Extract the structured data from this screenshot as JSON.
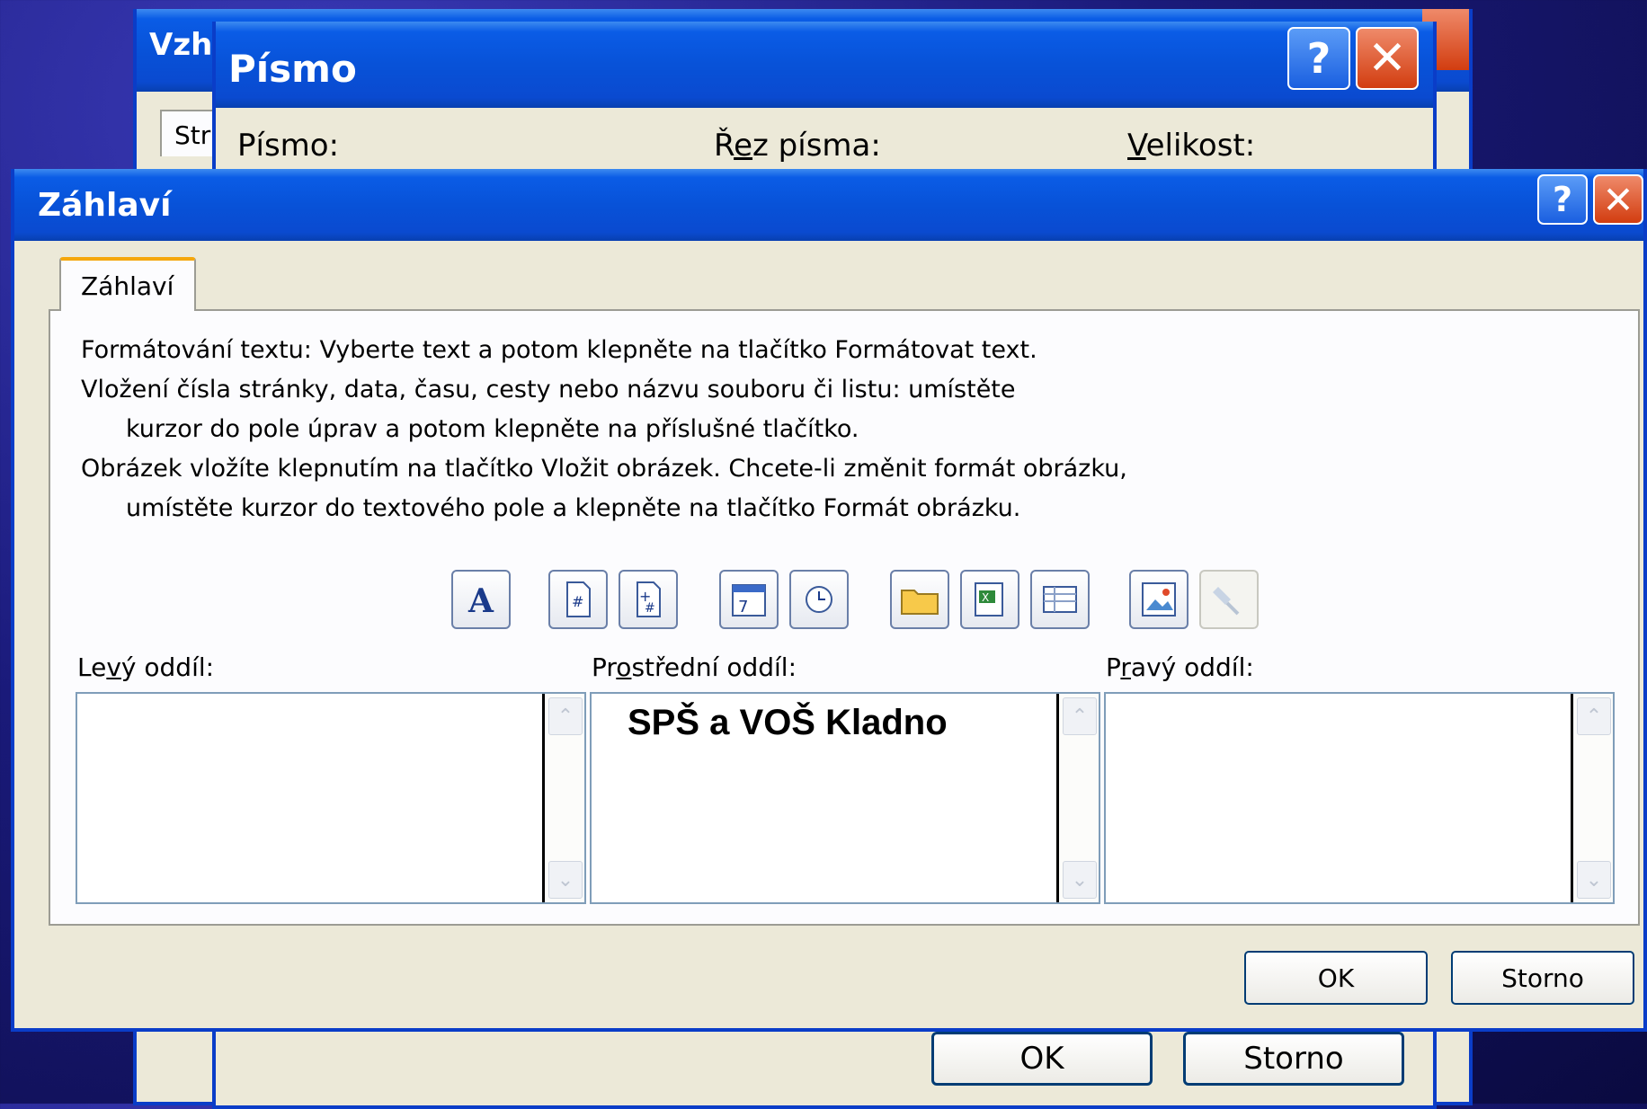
{
  "back_dialog": {
    "title": "Vzhl",
    "tab_label": "Str"
  },
  "font_dialog": {
    "title": "Písmo",
    "font_label": "Písmo:",
    "style_label_pre": "Ř",
    "style_label_u": "e",
    "style_label_post": "z písma:",
    "size_label_u": "V",
    "size_label_post": "elikost:",
    "ok": "OK",
    "cancel": "Storno"
  },
  "header_dialog": {
    "title": "Záhlaví",
    "tab": "Záhlaví",
    "instructions": [
      "Formátování textu: Vyberte text a potom klepněte na tlačítko Formátovat text.",
      "Vložení čísla stránky, data, času, cesty nebo názvu souboru či listu: umístěte",
      "kurzor do pole úprav a potom klepněte na příslušné tlačítko.",
      "Obrázek vložíte klepnutím na tlačítko Vložit obrázek. Chcete-li změnit formát obrázku,",
      "umístěte kurzor do textového pole a klepněte na tlačítko Formát obrázku."
    ],
    "toolbar_icons": [
      "format-text-icon",
      "page-number-icon",
      "total-pages-icon",
      "date-icon",
      "time-icon",
      "file-path-icon",
      "file-name-icon",
      "sheet-name-icon",
      "insert-picture-icon",
      "format-picture-icon"
    ],
    "left_label_pre": "Le",
    "left_label_u": "v",
    "left_label_post": "ý oddíl:",
    "center_label_pre": "Pr",
    "center_label_u": "o",
    "center_label_post": "střední oddíl:",
    "right_label_pre": "P",
    "right_label_u": "r",
    "right_label_post": "avý oddíl:",
    "left_text": "",
    "center_text": "SPŠ a VOŠ Kladno",
    "right_text": "",
    "ok": "OK",
    "cancel": "Storno"
  }
}
